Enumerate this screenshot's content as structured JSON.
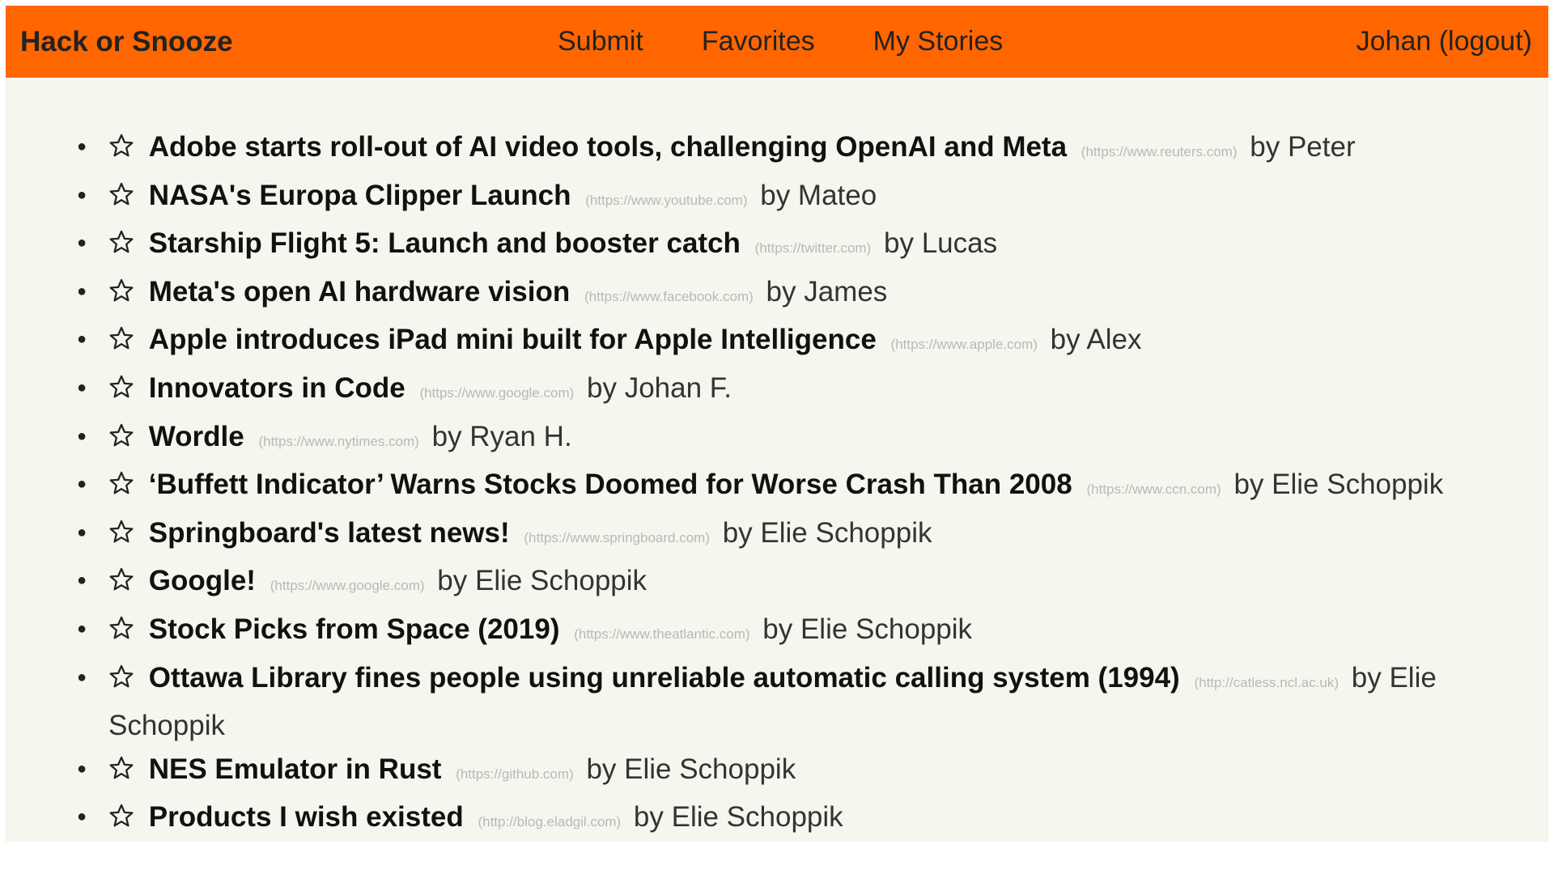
{
  "navbar": {
    "brand": "Hack or Snooze",
    "links": [
      "Submit",
      "Favorites",
      "My Stories"
    ],
    "user_label": "Johan (logout)"
  },
  "colors": {
    "navbar_bg": "#ff6600",
    "page_bg": "#f6f6ef"
  },
  "star_icon": "star-outline-icon",
  "stories": [
    {
      "title": "Adobe starts roll-out of AI video tools, challenging OpenAI and Meta",
      "host": "(https://www.reuters.com)",
      "author": "by Peter"
    },
    {
      "title": "NASA's Europa Clipper Launch",
      "host": "(https://www.youtube.com)",
      "author": "by Mateo"
    },
    {
      "title": "Starship Flight 5: Launch and booster catch",
      "host": "(https://twitter.com)",
      "author": "by Lucas"
    },
    {
      "title": "Meta's open AI hardware vision",
      "host": "(https://www.facebook.com)",
      "author": "by James"
    },
    {
      "title": "Apple introduces iPad mini built for Apple Intelligence",
      "host": "(https://www.apple.com)",
      "author": "by Alex"
    },
    {
      "title": "Innovators in Code",
      "host": "(https://www.google.com)",
      "author": "by Johan F."
    },
    {
      "title": "Wordle",
      "host": "(https://www.nytimes.com)",
      "author": "by Ryan H."
    },
    {
      "title": "‘Buffett Indicator’ Warns Stocks Doomed for Worse Crash Than 2008",
      "host": "(https://www.ccn.com)",
      "author": "by Elie Schoppik"
    },
    {
      "title": "Springboard's latest news!",
      "host": "(https://www.springboard.com)",
      "author": "by Elie Schoppik"
    },
    {
      "title": "Google!",
      "host": "(https://www.google.com)",
      "author": "by Elie Schoppik"
    },
    {
      "title": "Stock Picks from Space (2019)",
      "host": "(https://www.theatlantic.com)",
      "author": "by Elie Schoppik"
    },
    {
      "title": "Ottawa Library fines people using unreliable automatic calling system (1994)",
      "host": "(http://catless.ncl.ac.uk)",
      "author": "by Elie Schoppik"
    },
    {
      "title": "NES Emulator in Rust",
      "host": "(https://github.com)",
      "author": "by Elie Schoppik"
    },
    {
      "title": "Products I wish existed",
      "host": "(http://blog.eladgil.com)",
      "author": "by Elie Schoppik"
    }
  ]
}
